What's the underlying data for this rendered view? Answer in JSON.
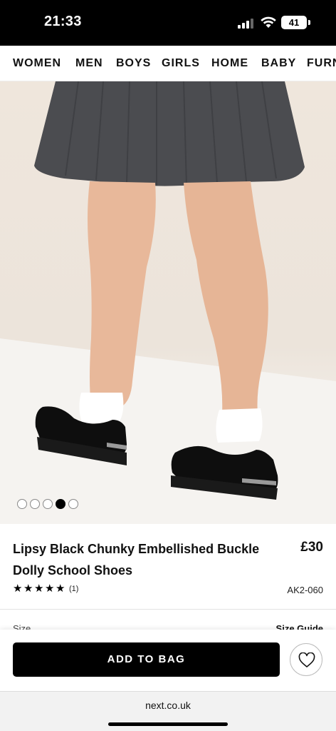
{
  "status_bar": {
    "time": "21:33",
    "battery": "41"
  },
  "nav": {
    "items": [
      "WOMEN",
      "MEN",
      "BOYS",
      "GIRLS",
      "HOME",
      "BABY",
      "FURN"
    ]
  },
  "gallery": {
    "image_count": 5,
    "active_index": 3
  },
  "product": {
    "title": "Lipsy Black Chunky Embellished Buckle Dolly School Shoes",
    "price": "£30",
    "rating_stars": 5,
    "review_count": "(1)",
    "sku": "AK2-060"
  },
  "size": {
    "label": "Size",
    "guide": "Size Guide"
  },
  "actions": {
    "add_to_bag": "ADD TO BAG",
    "favourite_icon": "heart-icon"
  },
  "browser": {
    "url": "next.co.uk"
  }
}
